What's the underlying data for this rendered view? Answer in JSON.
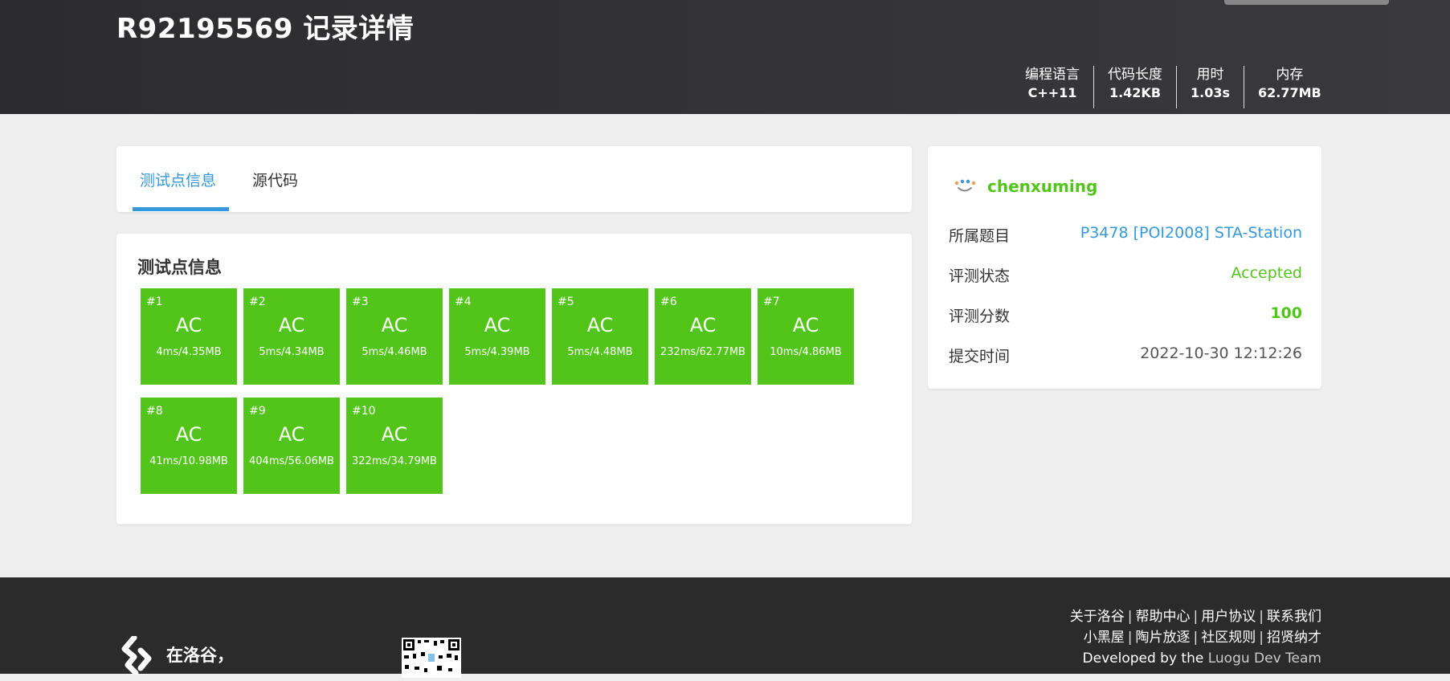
{
  "header": {
    "title": "R92195569 记录详情",
    "stats": [
      {
        "label": "编程语言",
        "value": "C++11"
      },
      {
        "label": "代码长度",
        "value": "1.42KB"
      },
      {
        "label": "用时",
        "value": "1.03s"
      },
      {
        "label": "内存",
        "value": "62.77MB"
      }
    ]
  },
  "tabs": [
    {
      "label": "测试点信息",
      "active": true
    },
    {
      "label": "源代码",
      "active": false
    }
  ],
  "tests": {
    "heading": "测试点信息",
    "color": "#52c41a",
    "cases": [
      {
        "num": "#1",
        "status": "AC",
        "info": "4ms/4.35MB"
      },
      {
        "num": "#2",
        "status": "AC",
        "info": "5ms/4.34MB"
      },
      {
        "num": "#3",
        "status": "AC",
        "info": "5ms/4.46MB"
      },
      {
        "num": "#4",
        "status": "AC",
        "info": "5ms/4.39MB"
      },
      {
        "num": "#5",
        "status": "AC",
        "info": "5ms/4.48MB"
      },
      {
        "num": "#6",
        "status": "AC",
        "info": "232ms/62.77MB"
      },
      {
        "num": "#7",
        "status": "AC",
        "info": "10ms/4.86MB"
      },
      {
        "num": "#8",
        "status": "AC",
        "info": "41ms/10.98MB"
      },
      {
        "num": "#9",
        "status": "AC",
        "info": "404ms/56.06MB"
      },
      {
        "num": "#10",
        "status": "AC",
        "info": "322ms/34.79MB"
      }
    ]
  },
  "sidebar": {
    "username": "chenxuming",
    "rows": [
      {
        "label": "所属题目",
        "value": "P3478 [POI2008] STA-Station",
        "color": "#3498db"
      },
      {
        "label": "评测状态",
        "value": "Accepted",
        "color": "#52c41a"
      },
      {
        "label": "评测分数",
        "value": "100",
        "color": "#52c41a"
      },
      {
        "label": "提交时间",
        "value": "2022-10-30 12:12:26",
        "color": "#555555"
      }
    ]
  },
  "footer": {
    "slogan": "在洛谷，",
    "links_row1": [
      "关于洛谷",
      "帮助中心",
      "用户协议",
      "联系我们"
    ],
    "links_row2": [
      "小黑屋",
      "陶片放逐",
      "社区规则",
      "招贤纳才"
    ],
    "dev_prefix": "Developed by the",
    "dev_team": "Luogu Dev Team"
  }
}
